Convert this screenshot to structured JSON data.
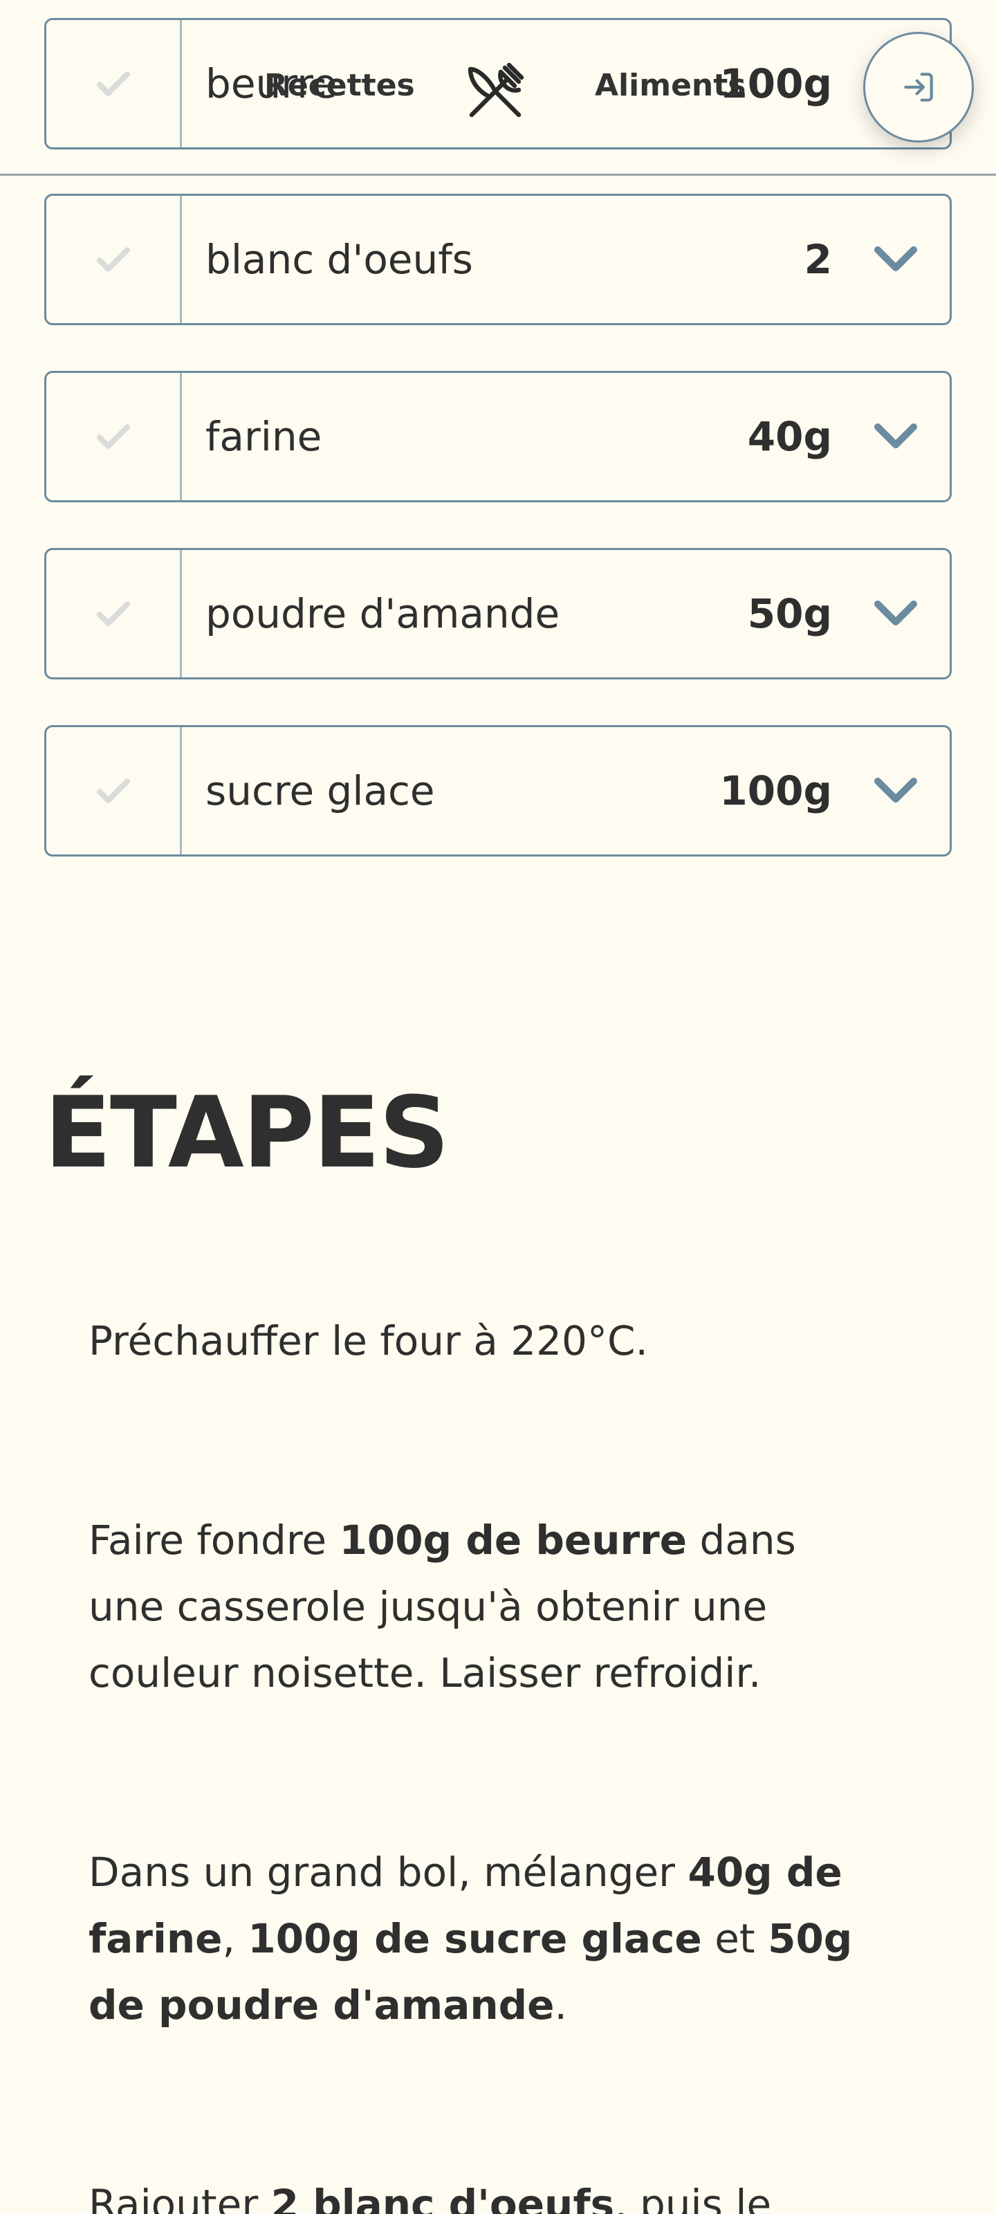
{
  "nav": {
    "recipes_label": "Recettes",
    "foods_label": "Aliments",
    "logo_icon": "fork-knife-icon",
    "login_icon": "login-icon"
  },
  "colors": {
    "background": "#fefbf0",
    "accent": "#6a8ba0",
    "text": "#2f2f2f",
    "check": "#d9dcd8"
  },
  "ingredients": [
    {
      "name": "beurre",
      "quantity": "100g"
    },
    {
      "name": "blanc d'oeufs",
      "quantity": "2"
    },
    {
      "name": "farine",
      "quantity": "40g"
    },
    {
      "name": "poudre d'amande",
      "quantity": "50g"
    },
    {
      "name": "sucre glace",
      "quantity": "100g"
    }
  ],
  "steps_title": "ÉTAPES",
  "steps": [
    {
      "parts": [
        {
          "text": "Préchauffer le four à 220°C.",
          "bold": false
        }
      ]
    },
    {
      "parts": [
        {
          "text": "Faire fondre ",
          "bold": false
        },
        {
          "text": "100g de beurre",
          "bold": true
        },
        {
          "text": " dans une casserole jusqu'à obtenir une couleur noisette. Laisser refroidir.",
          "bold": false
        }
      ]
    },
    {
      "parts": [
        {
          "text": "Dans un grand bol, mélanger ",
          "bold": false
        },
        {
          "text": "40g de farine",
          "bold": true
        },
        {
          "text": ", ",
          "bold": false
        },
        {
          "text": "100g de sucre glace",
          "bold": true
        },
        {
          "text": " et ",
          "bold": false
        },
        {
          "text": "50g de poudre d'amande",
          "bold": true
        },
        {
          "text": ".",
          "bold": false
        }
      ]
    },
    {
      "parts": [
        {
          "text": "Rajouter ",
          "bold": false
        },
        {
          "text": "2 blanc d'oeufs",
          "bold": true
        },
        {
          "text": ", puis le beurre",
          "bold": false
        }
      ]
    }
  ]
}
